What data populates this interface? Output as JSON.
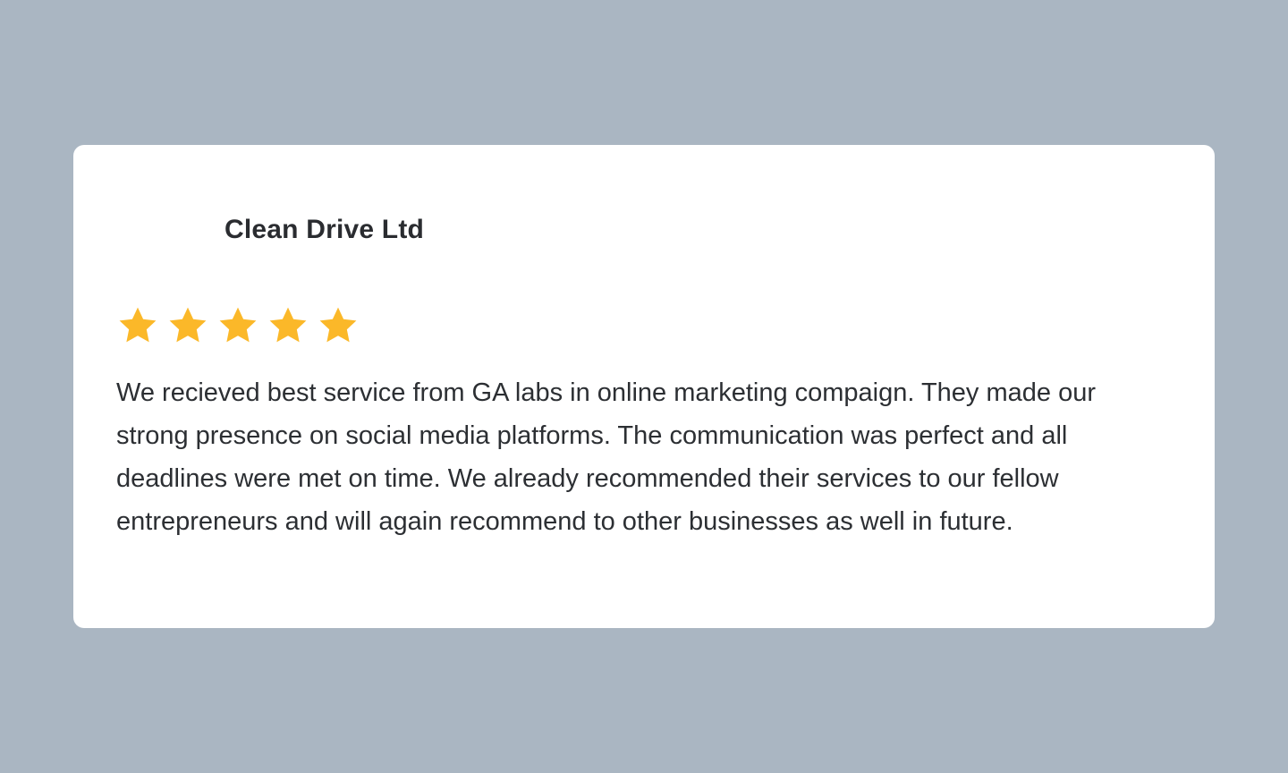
{
  "review": {
    "company": "Clean Drive Ltd",
    "rating": 5,
    "rating_max": 5,
    "star_icon": "star-icon",
    "star_color": "#fbb829",
    "text": "We recieved best service from GA labs in online marketing compaign. They made our strong presence on social media platforms. The communication was perfect and all deadlines were met on time. We already recommended their services to our fellow entrepreneurs and will again recommend to other businesses as well in future."
  },
  "colors": {
    "background": "#aab6c2",
    "card": "#ffffff",
    "text": "#2c2f33"
  }
}
